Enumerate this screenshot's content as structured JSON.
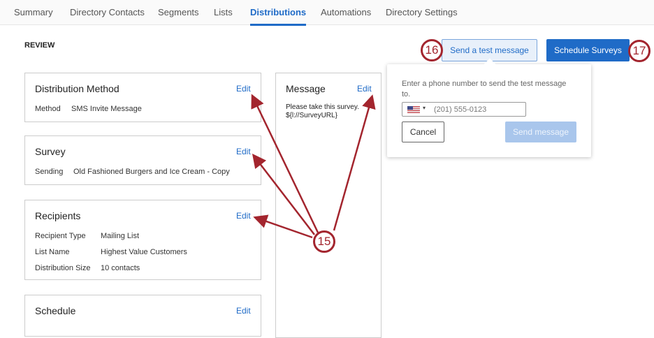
{
  "tabs": [
    "Summary",
    "Directory Contacts",
    "Segments",
    "Lists",
    "Distributions",
    "Automations",
    "Directory Settings"
  ],
  "review_title": "REVIEW",
  "edit_label": "Edit",
  "distribution_method": {
    "title": "Distribution Method",
    "method_label": "Method",
    "method_value": "SMS Invite Message"
  },
  "survey": {
    "title": "Survey",
    "sending_label": "Sending",
    "sending_value": "Old Fashioned Burgers and Ice Cream - Copy"
  },
  "recipients": {
    "title": "Recipients",
    "rows": [
      {
        "label": "Recipient Type",
        "value": "Mailing List"
      },
      {
        "label": "List Name",
        "value": "Highest Value Customers"
      },
      {
        "label": "Distribution Size",
        "value": "10 contacts"
      }
    ]
  },
  "schedule": {
    "title": "Schedule"
  },
  "message": {
    "title": "Message",
    "body_line1": "Please take this survey.",
    "body_line2": "${l://SurveyURL}"
  },
  "buttons": {
    "send_test": "Send a test message",
    "schedule": "Schedule Surveys"
  },
  "popover": {
    "prompt": "Enter a phone number to send the test message to.",
    "phone_placeholder": "(201) 555-0123",
    "cancel": "Cancel",
    "send": "Send message"
  },
  "callouts": {
    "c15": "15",
    "c16": "16",
    "c17": "17"
  }
}
